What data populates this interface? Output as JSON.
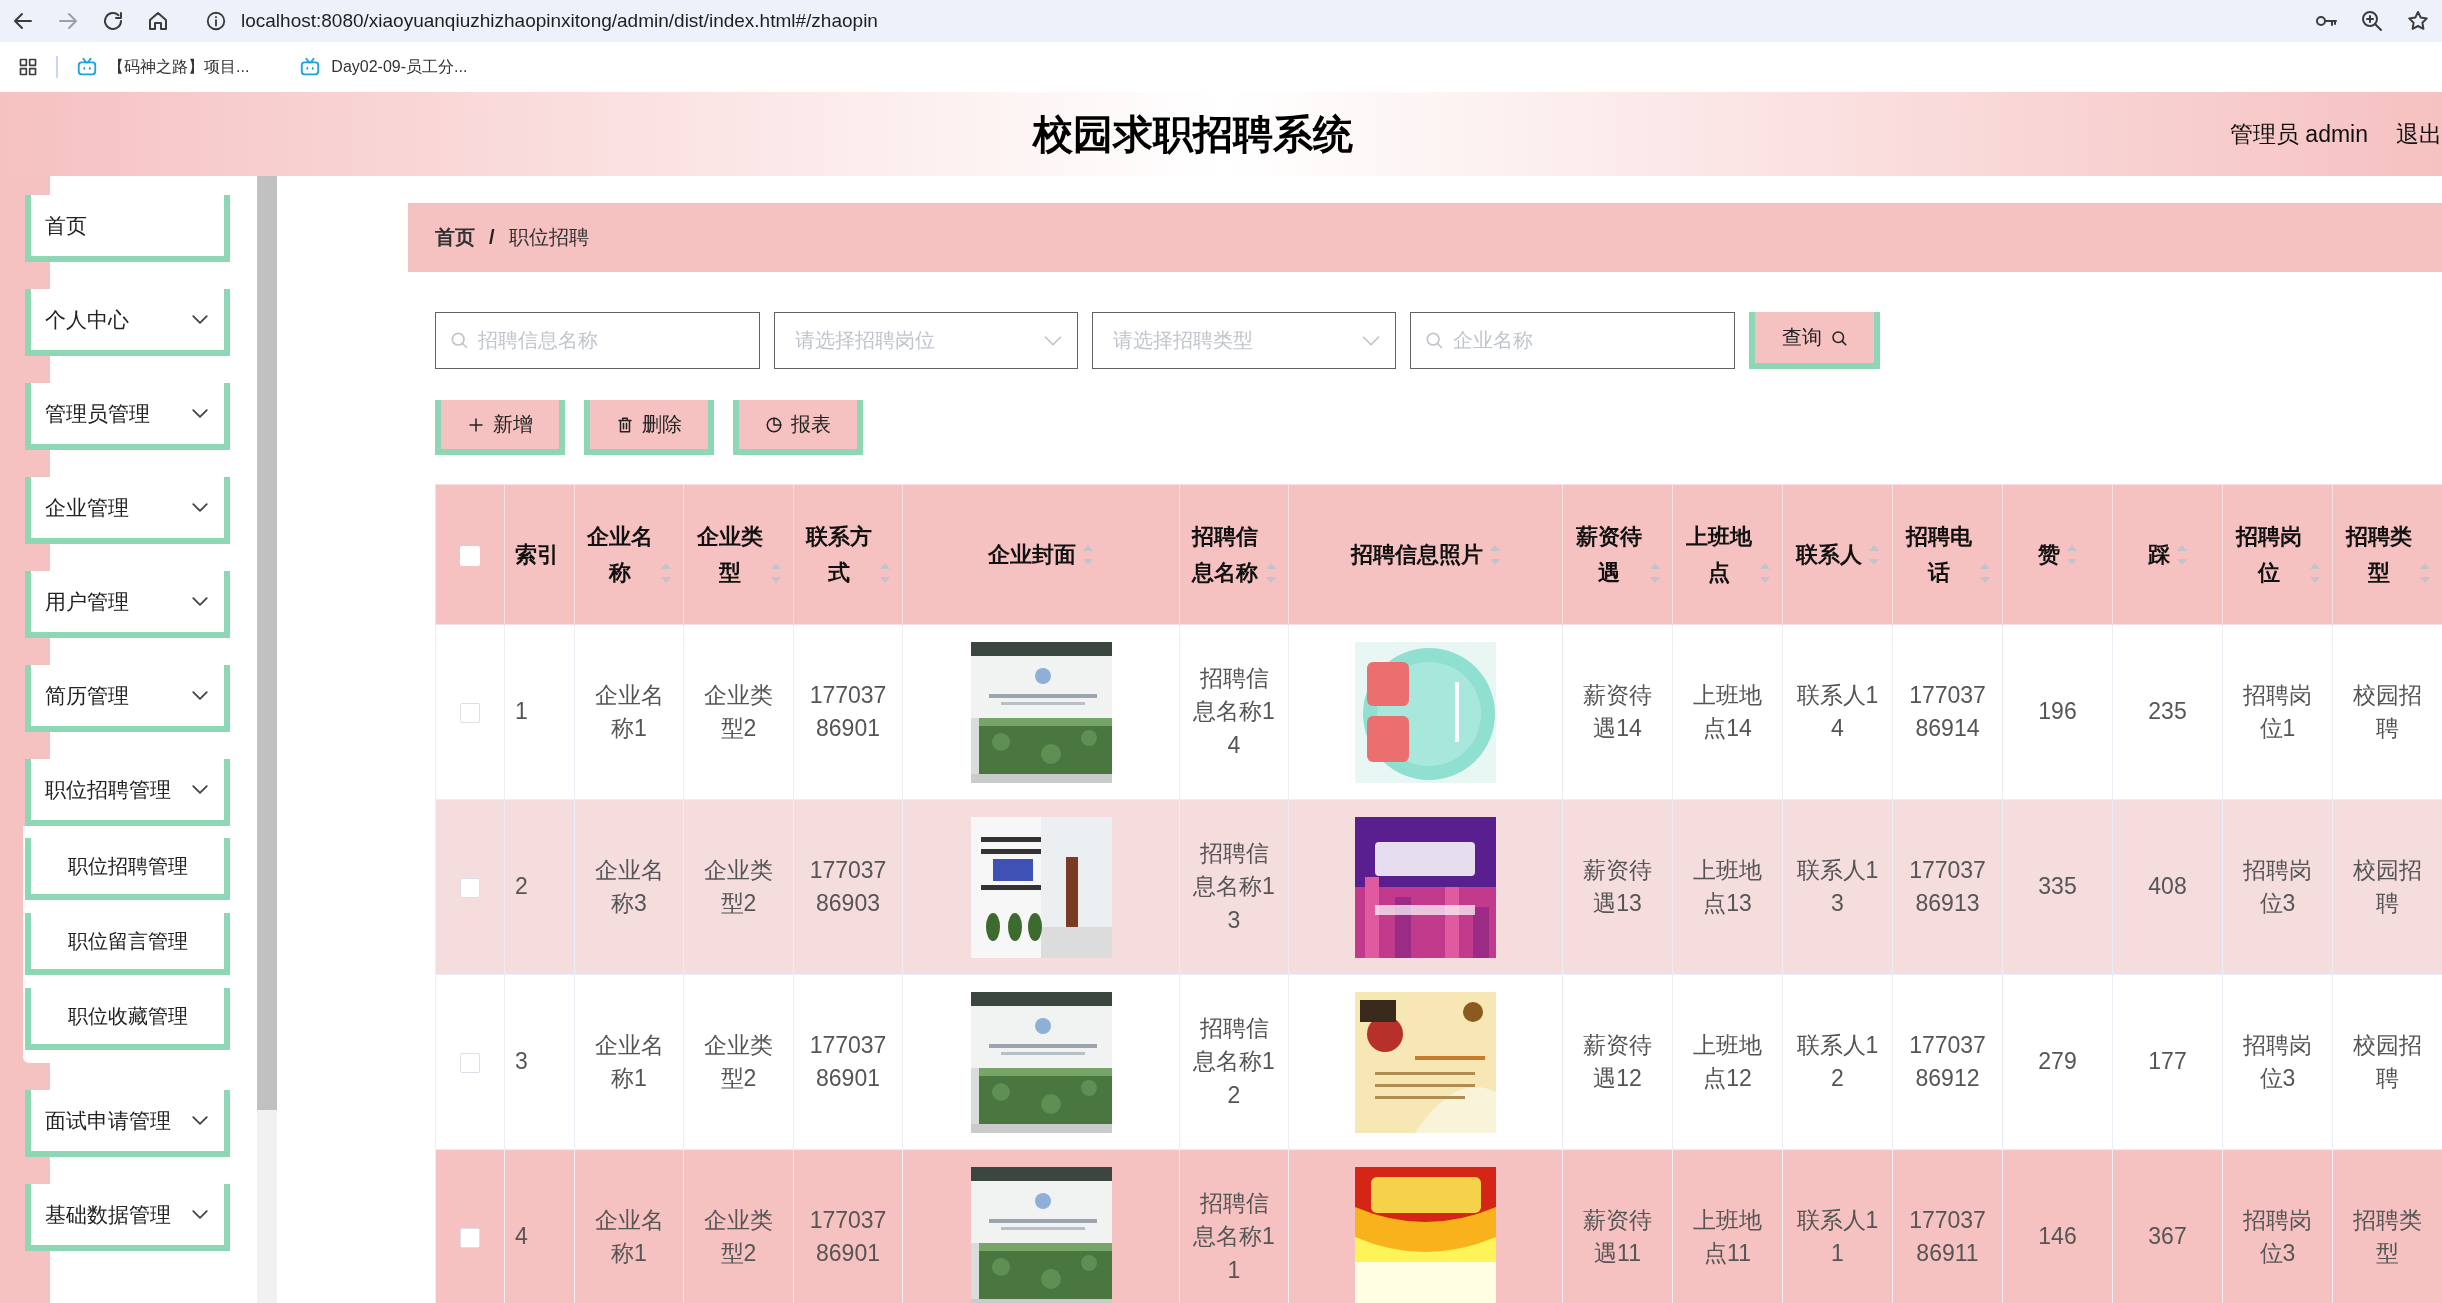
{
  "browser": {
    "url": "localhost:8080/xiaoyuanqiuzhizhaopinxitong/admin/dist/index.html#/zhaopin",
    "bookmarks": [
      {
        "label": "【码神之路】项目..."
      },
      {
        "label": "Day02-09-员工分..."
      }
    ]
  },
  "header": {
    "title": "校园求职招聘系统",
    "user": "管理员 admin",
    "logout": "退出"
  },
  "sidebar": {
    "items": [
      {
        "label": "首页",
        "kind": "link"
      },
      {
        "label": "个人中心",
        "kind": "menu",
        "expanded": false
      },
      {
        "label": "管理员管理",
        "kind": "menu",
        "expanded": false
      },
      {
        "label": "企业管理",
        "kind": "menu",
        "expanded": false
      },
      {
        "label": "用户管理",
        "kind": "menu",
        "expanded": false
      },
      {
        "label": "简历管理",
        "kind": "menu",
        "expanded": false
      },
      {
        "label": "职位招聘管理",
        "kind": "menu",
        "expanded": true,
        "children": [
          {
            "label": "职位招聘管理"
          },
          {
            "label": "职位留言管理"
          },
          {
            "label": "职位收藏管理"
          }
        ]
      },
      {
        "label": "面试申请管理",
        "kind": "menu",
        "expanded": false
      },
      {
        "label": "基础数据管理",
        "kind": "menu",
        "expanded": false
      }
    ]
  },
  "breadcrumb": {
    "separator": "/",
    "items": [
      {
        "label": "首页",
        "current": false
      },
      {
        "label": "职位招聘",
        "current": true
      }
    ]
  },
  "filters": [
    {
      "kind": "search",
      "placeholder": "招聘信息名称"
    },
    {
      "kind": "select",
      "placeholder": "请选择招聘岗位"
    },
    {
      "kind": "select",
      "placeholder": "请选择招聘类型"
    },
    {
      "kind": "search",
      "placeholder": "企业名称"
    }
  ],
  "query_button": "查询",
  "actions": [
    {
      "kind": "add",
      "label": "新增"
    },
    {
      "kind": "delete",
      "label": "删除"
    },
    {
      "kind": "report",
      "label": "报表"
    }
  ],
  "table": {
    "select_all": {
      "checked": false
    },
    "columns": [
      {
        "label": "索引",
        "sortable": false
      },
      {
        "label": "企业名称",
        "sortable": true
      },
      {
        "label": "企业类型",
        "sortable": true
      },
      {
        "label": "联系方式",
        "sortable": true
      },
      {
        "label": "企业封面",
        "sortable": true
      },
      {
        "label": "招聘信息名称",
        "sortable": true
      },
      {
        "label": "招聘信息照片",
        "sortable": true
      },
      {
        "label": "薪资待遇",
        "sortable": true
      },
      {
        "label": "上班地点",
        "sortable": true
      },
      {
        "label": "联系人",
        "sortable": true
      },
      {
        "label": "招聘电话",
        "sortable": true
      },
      {
        "label": "赞",
        "sortable": true
      },
      {
        "label": "踩",
        "sortable": true
      },
      {
        "label": "招聘岗位",
        "sortable": true
      },
      {
        "label": "招聘类型",
        "sortable": true
      }
    ],
    "rows": [
      {
        "checked": false,
        "highlighted": false,
        "cells": [
          "1",
          "企业名称1",
          "企业类型2",
          "17703786901",
          {
            "kind": "picture"
          },
          "招聘信息名称14",
          {
            "kind": "picture"
          },
          "薪资待遇14",
          "上班地点14",
          "联系人14",
          "17703786914",
          "196",
          "235",
          "招聘岗位1",
          "校园招聘"
        ]
      },
      {
        "checked": false,
        "highlighted": false,
        "cells": [
          "2",
          "企业名称3",
          "企业类型2",
          "17703786903",
          {
            "kind": "picture"
          },
          "招聘信息名称13",
          {
            "kind": "picture"
          },
          "薪资待遇13",
          "上班地点13",
          "联系人13",
          "17703786913",
          "335",
          "408",
          "招聘岗位3",
          "校园招聘"
        ]
      },
      {
        "checked": false,
        "highlighted": false,
        "cells": [
          "3",
          "企业名称1",
          "企业类型2",
          "17703786901",
          {
            "kind": "picture"
          },
          "招聘信息名称12",
          {
            "kind": "picture"
          },
          "薪资待遇12",
          "上班地点12",
          "联系人12",
          "17703786912",
          "279",
          "177",
          "招聘岗位3",
          "校园招聘"
        ]
      },
      {
        "checked": false,
        "highlighted": true,
        "cells": [
          "4",
          "企业名称1",
          "企业类型2",
          "17703786901",
          {
            "kind": "picture"
          },
          "招聘信息名称11",
          {
            "kind": "picture"
          },
          "薪资待遇11",
          "上班地点11",
          "联系人11",
          "17703786911",
          "146",
          "367",
          "招聘岗位3",
          "招聘类型"
        ]
      }
    ]
  }
}
